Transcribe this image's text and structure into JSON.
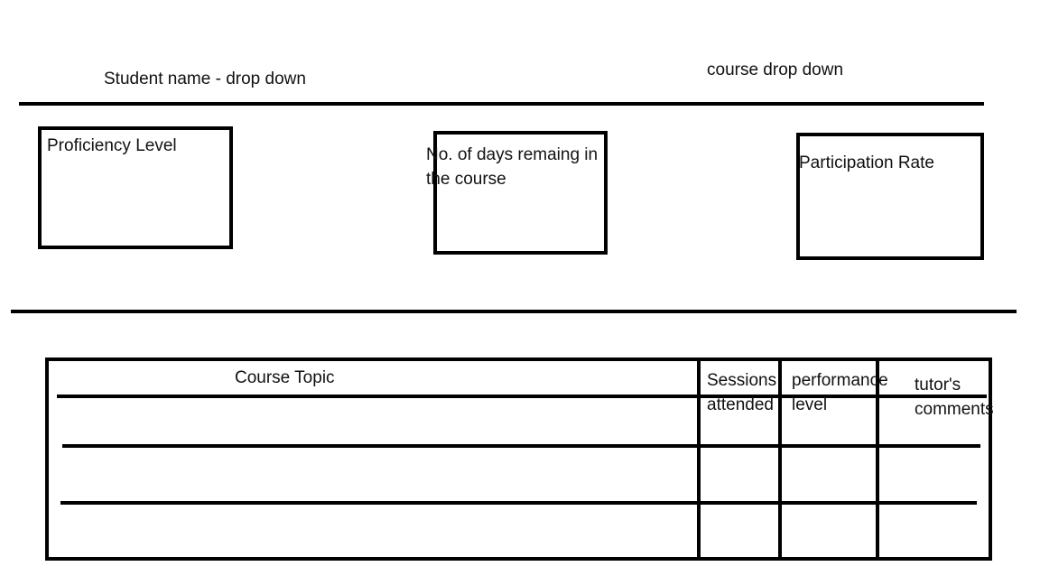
{
  "filters": {
    "student_label": "Student name - drop down",
    "course_label": "course drop down"
  },
  "kpis": {
    "proficiency_label": "Proficiency Level",
    "days_remaining_line1": "No. of days remaing in",
    "days_remaining_line2": "the course",
    "participation_label": "Participation Rate"
  },
  "table": {
    "col_topic": "Course Topic",
    "col_sessions_line1": "Sessions",
    "col_sessions_line2": "attended",
    "col_performance_line1": "performance",
    "col_performance_line2": "level",
    "col_comments_line1": "tutor's",
    "col_comments_line2": "comments"
  }
}
